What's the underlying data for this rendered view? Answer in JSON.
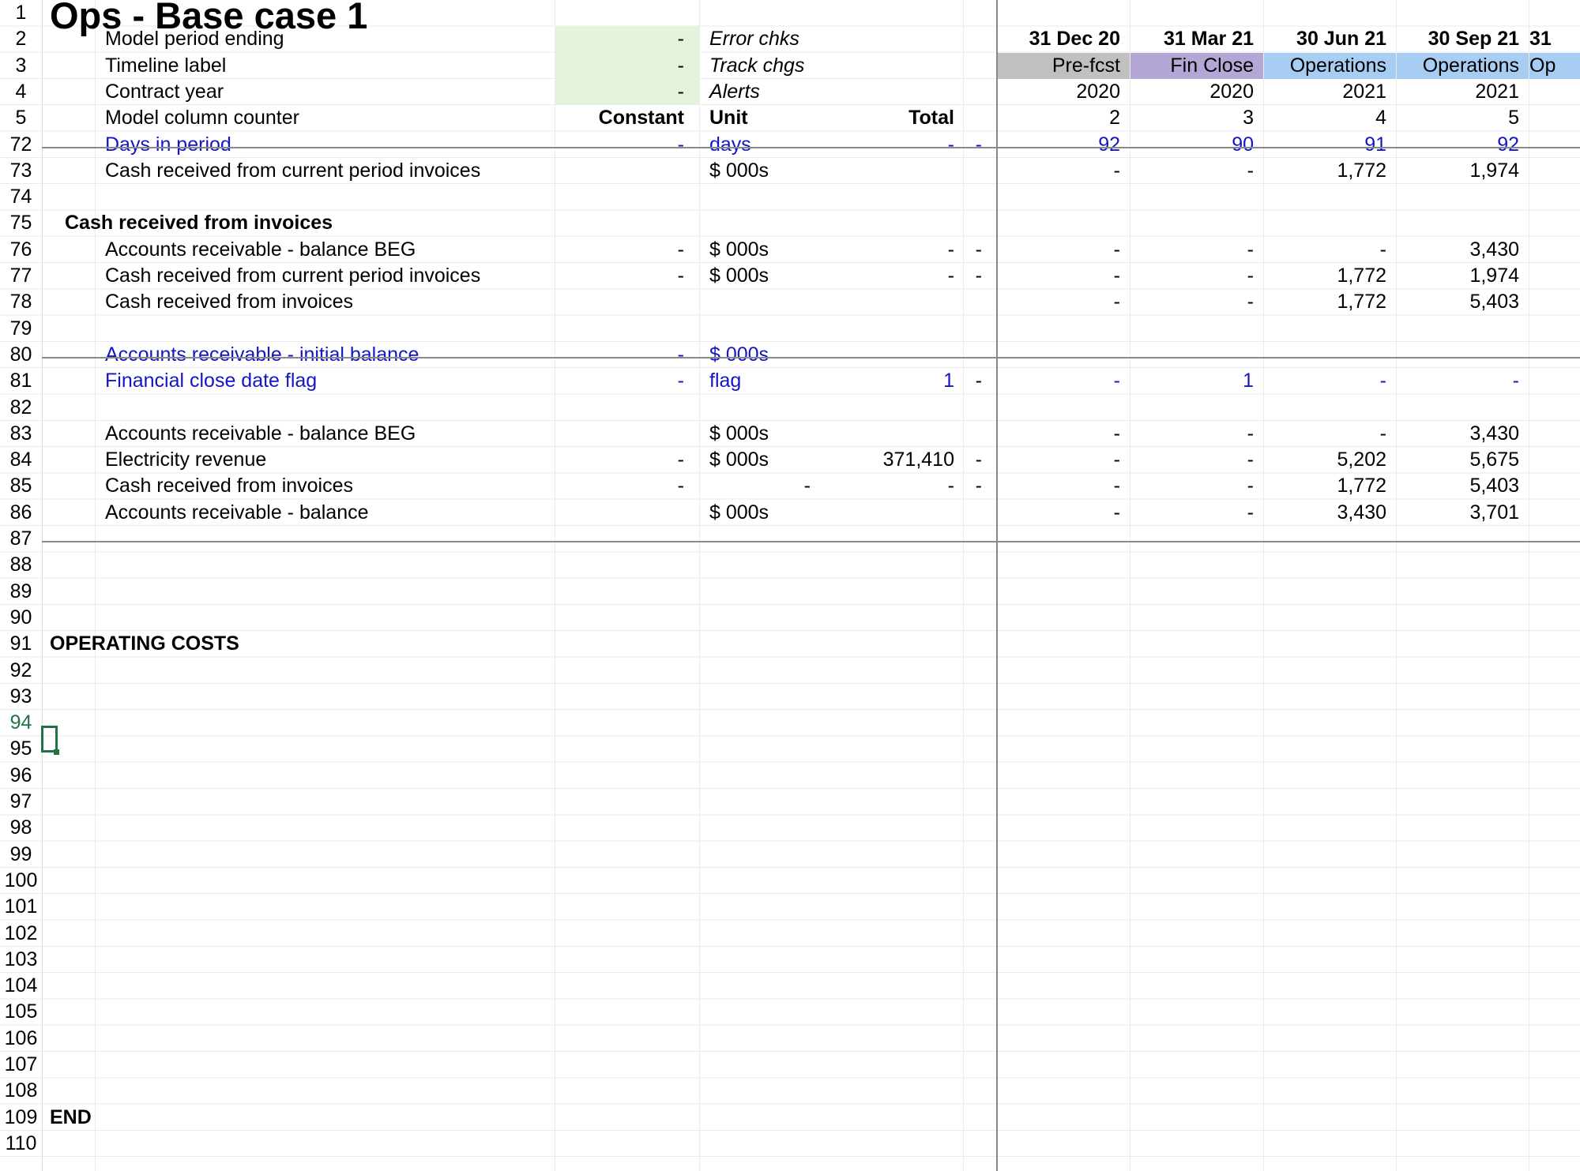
{
  "sheet": {
    "title": "Ops - Base case 1",
    "colors": {
      "input_fill": "#e6f3dc",
      "prefcst_fill": "#c0c0c0",
      "finclose_fill": "#b4a7d6",
      "operations_fill": "#a7cdf3",
      "input_text": "#1515c8",
      "selection": "#217346"
    },
    "selected_row": "94",
    "rows": [
      {
        "n": "1",
        "cells": [
          {
            "col": "a",
            "text": "Ops - Base case 1",
            "style": "title"
          }
        ]
      },
      {
        "n": "2",
        "cells": [
          {
            "col": "b",
            "text": "Model period ending"
          },
          {
            "col": "e",
            "text": "-",
            "fill": "input"
          },
          {
            "col": "f",
            "text": "Error chks",
            "style": "ital"
          },
          {
            "col": "h",
            "text": "31 Dec 20",
            "style": "bold"
          },
          {
            "col": "i",
            "text": "31 Mar 21",
            "style": "bold"
          },
          {
            "col": "j",
            "text": "30 Jun 21",
            "style": "bold"
          },
          {
            "col": "k",
            "text": "30 Sep 21",
            "style": "bold"
          },
          {
            "col": "l",
            "text": "31",
            "style": "bold"
          }
        ]
      },
      {
        "n": "3",
        "cells": [
          {
            "col": "b",
            "text": "Timeline label"
          },
          {
            "col": "e",
            "text": "-",
            "fill": "input"
          },
          {
            "col": "f",
            "text": "Track chgs",
            "style": "ital"
          },
          {
            "col": "h",
            "text": "Pre-fcst",
            "fill": "prefcst"
          },
          {
            "col": "i",
            "text": "Fin Close",
            "fill": "finclose"
          },
          {
            "col": "j",
            "text": "Operations",
            "fill": "operations"
          },
          {
            "col": "k",
            "text": "Operations",
            "fill": "operations"
          },
          {
            "col": "l",
            "text": "Op",
            "fill": "operations"
          }
        ]
      },
      {
        "n": "4",
        "cells": [
          {
            "col": "b",
            "text": "Contract year"
          },
          {
            "col": "e",
            "text": "-",
            "fill": "input"
          },
          {
            "col": "f",
            "text": "Alerts",
            "style": "ital"
          },
          {
            "col": "h",
            "text": "2020"
          },
          {
            "col": "i",
            "text": "2020"
          },
          {
            "col": "j",
            "text": "2021"
          },
          {
            "col": "k",
            "text": "2021"
          }
        ]
      },
      {
        "n": "5",
        "cells": [
          {
            "col": "b",
            "text": "Model column counter"
          },
          {
            "col": "e",
            "text": "Constant",
            "style": "bold"
          },
          {
            "col": "f",
            "text": "Unit",
            "style": "bold"
          },
          {
            "col": "g",
            "text": "Total",
            "style": "bold"
          },
          {
            "col": "h",
            "text": "2"
          },
          {
            "col": "i",
            "text": "3"
          },
          {
            "col": "j",
            "text": "4"
          },
          {
            "col": "k",
            "text": "5"
          }
        ]
      },
      {
        "n": "72",
        "cells": [
          {
            "col": "b",
            "text": "Days in period",
            "style": "blue"
          },
          {
            "col": "e",
            "text": "-",
            "style": "blue"
          },
          {
            "col": "f",
            "text": "days",
            "style": "blue"
          },
          {
            "col": "g",
            "text": "-",
            "style": "blue"
          },
          {
            "col": "g2",
            "text": "-",
            "style": "blue"
          },
          {
            "col": "h",
            "text": "92",
            "style": "blue"
          },
          {
            "col": "i",
            "text": "90",
            "style": "blue"
          },
          {
            "col": "j",
            "text": "91",
            "style": "blue"
          },
          {
            "col": "k",
            "text": "92",
            "style": "blue"
          }
        ]
      },
      {
        "n": "73",
        "cells": [
          {
            "col": "b",
            "text": "Cash received from current period invoices"
          },
          {
            "col": "f",
            "text": "$ 000s"
          },
          {
            "col": "h",
            "text": "-"
          },
          {
            "col": "i",
            "text": "-"
          },
          {
            "col": "j",
            "text": "1,772"
          },
          {
            "col": "k",
            "text": "1,974"
          }
        ]
      },
      {
        "n": "74",
        "cells": []
      },
      {
        "n": "75",
        "cells": [
          {
            "col": "a2",
            "text": "Cash received from invoices",
            "style": "bold"
          }
        ]
      },
      {
        "n": "76",
        "cells": [
          {
            "col": "b",
            "text": "Accounts receivable - balance BEG"
          },
          {
            "col": "e",
            "text": "-"
          },
          {
            "col": "f",
            "text": "$ 000s"
          },
          {
            "col": "g",
            "text": "-"
          },
          {
            "col": "g2",
            "text": "-"
          },
          {
            "col": "h",
            "text": "-"
          },
          {
            "col": "i",
            "text": "-"
          },
          {
            "col": "j",
            "text": "-"
          },
          {
            "col": "k",
            "text": "3,430"
          }
        ]
      },
      {
        "n": "77",
        "cells": [
          {
            "col": "b",
            "text": "Cash received from current period invoices"
          },
          {
            "col": "e",
            "text": "-"
          },
          {
            "col": "f",
            "text": "$ 000s"
          },
          {
            "col": "g",
            "text": "-"
          },
          {
            "col": "g2",
            "text": "-"
          },
          {
            "col": "h",
            "text": "-"
          },
          {
            "col": "i",
            "text": "-"
          },
          {
            "col": "j",
            "text": "1,772"
          },
          {
            "col": "k",
            "text": "1,974"
          }
        ]
      },
      {
        "n": "78",
        "cells": [
          {
            "col": "b",
            "text": "Cash received from invoices"
          },
          {
            "col": "h",
            "text": "-"
          },
          {
            "col": "i",
            "text": "-"
          },
          {
            "col": "j",
            "text": "1,772"
          },
          {
            "col": "k",
            "text": "5,403"
          }
        ]
      },
      {
        "n": "79",
        "cells": []
      },
      {
        "n": "80",
        "cells": [
          {
            "col": "b",
            "text": "Accounts receivable - initial balance",
            "style": "blue"
          },
          {
            "col": "e",
            "text": "-",
            "style": "blue"
          },
          {
            "col": "f",
            "text": "$ 000s",
            "style": "blue"
          }
        ]
      },
      {
        "n": "81",
        "cells": [
          {
            "col": "b",
            "text": "Financial close date flag",
            "style": "blue"
          },
          {
            "col": "e",
            "text": "-",
            "style": "blue"
          },
          {
            "col": "f",
            "text": "flag",
            "style": "blue"
          },
          {
            "col": "g",
            "text": "1",
            "style": "blue"
          },
          {
            "col": "g2",
            "text": "-"
          },
          {
            "col": "h",
            "text": "-",
            "style": "blue"
          },
          {
            "col": "i",
            "text": "1",
            "style": "blue"
          },
          {
            "col": "j",
            "text": "-",
            "style": "blue"
          },
          {
            "col": "k",
            "text": "-",
            "style": "blue"
          }
        ]
      },
      {
        "n": "82",
        "cells": []
      },
      {
        "n": "83",
        "cells": [
          {
            "col": "b",
            "text": "Accounts receivable - balance BEG"
          },
          {
            "col": "f",
            "text": "$ 000s"
          },
          {
            "col": "h",
            "text": "-"
          },
          {
            "col": "i",
            "text": "-"
          },
          {
            "col": "j",
            "text": "-"
          },
          {
            "col": "k",
            "text": "3,430"
          }
        ]
      },
      {
        "n": "84",
        "cells": [
          {
            "col": "b",
            "text": "Electricity revenue"
          },
          {
            "col": "e",
            "text": "-"
          },
          {
            "col": "f",
            "text": "$ 000s"
          },
          {
            "col": "g",
            "text": "371,410"
          },
          {
            "col": "g2",
            "text": "-"
          },
          {
            "col": "h",
            "text": "-"
          },
          {
            "col": "i",
            "text": "-"
          },
          {
            "col": "j",
            "text": "5,202"
          },
          {
            "col": "k",
            "text": "5,675"
          }
        ]
      },
      {
        "n": "85",
        "cells": [
          {
            "col": "b",
            "text": "Cash received from invoices"
          },
          {
            "col": "e",
            "text": "-"
          },
          {
            "col": "f2",
            "text": "-"
          },
          {
            "col": "g",
            "text": "-"
          },
          {
            "col": "g2",
            "text": "-"
          },
          {
            "col": "h",
            "text": "-"
          },
          {
            "col": "i",
            "text": "-"
          },
          {
            "col": "j",
            "text": "1,772"
          },
          {
            "col": "k",
            "text": "5,403"
          }
        ]
      },
      {
        "n": "86",
        "cells": [
          {
            "col": "b",
            "text": "Accounts receivable - balance"
          },
          {
            "col": "f",
            "text": "$ 000s"
          },
          {
            "col": "h",
            "text": "-"
          },
          {
            "col": "i",
            "text": "-"
          },
          {
            "col": "j",
            "text": "3,430"
          },
          {
            "col": "k",
            "text": "3,701"
          }
        ]
      },
      {
        "n": "87",
        "cells": []
      },
      {
        "n": "88",
        "cells": []
      },
      {
        "n": "89",
        "cells": []
      },
      {
        "n": "90",
        "cells": []
      },
      {
        "n": "91",
        "cells": [
          {
            "col": "a",
            "text": "OPERATING COSTS",
            "style": "bold"
          }
        ]
      },
      {
        "n": "92",
        "cells": []
      },
      {
        "n": "93",
        "cells": []
      },
      {
        "n": "94",
        "cells": []
      },
      {
        "n": "95",
        "cells": []
      },
      {
        "n": "96",
        "cells": []
      },
      {
        "n": "97",
        "cells": []
      },
      {
        "n": "98",
        "cells": []
      },
      {
        "n": "99",
        "cells": []
      },
      {
        "n": "100",
        "cells": []
      },
      {
        "n": "101",
        "cells": []
      },
      {
        "n": "102",
        "cells": []
      },
      {
        "n": "103",
        "cells": []
      },
      {
        "n": "104",
        "cells": []
      },
      {
        "n": "105",
        "cells": []
      },
      {
        "n": "106",
        "cells": []
      },
      {
        "n": "107",
        "cells": []
      },
      {
        "n": "108",
        "cells": []
      },
      {
        "n": "109",
        "cells": [
          {
            "col": "a",
            "text": "END",
            "style": "bold"
          }
        ]
      },
      {
        "n": "110",
        "cells": []
      }
    ]
  }
}
